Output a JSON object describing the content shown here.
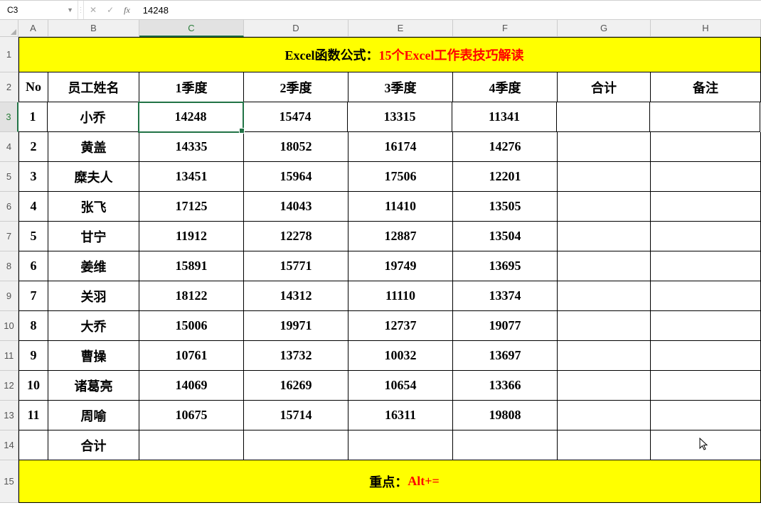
{
  "formula_bar": {
    "name_box": "C3",
    "formula_value": "14248"
  },
  "columns": [
    "A",
    "B",
    "C",
    "D",
    "E",
    "F",
    "G",
    "H"
  ],
  "active_col": "C",
  "active_row": "3",
  "title": {
    "prefix": "Excel函数公式：",
    "suffix": "15个Excel工作表技巧解读"
  },
  "headers": {
    "A": "No",
    "B": "员工姓名",
    "C": "1季度",
    "D": "2季度",
    "E": "3季度",
    "F": "4季度",
    "G": "合计",
    "H": "备注"
  },
  "rows": [
    {
      "no": "1",
      "name": "小乔",
      "q1": "14248",
      "q2": "15474",
      "q3": "13315",
      "q4": "11341",
      "sum": "",
      "note": ""
    },
    {
      "no": "2",
      "name": "黄盖",
      "q1": "14335",
      "q2": "18052",
      "q3": "16174",
      "q4": "14276",
      "sum": "",
      "note": ""
    },
    {
      "no": "3",
      "name": "糜夫人",
      "q1": "13451",
      "q2": "15964",
      "q3": "17506",
      "q4": "12201",
      "sum": "",
      "note": ""
    },
    {
      "no": "4",
      "name": "张飞",
      "q1": "17125",
      "q2": "14043",
      "q3": "11410",
      "q4": "13505",
      "sum": "",
      "note": ""
    },
    {
      "no": "5",
      "name": "甘宁",
      "q1": "11912",
      "q2": "12278",
      "q3": "12887",
      "q4": "13504",
      "sum": "",
      "note": ""
    },
    {
      "no": "6",
      "name": "姜维",
      "q1": "15891",
      "q2": "15771",
      "q3": "19749",
      "q4": "13695",
      "sum": "",
      "note": ""
    },
    {
      "no": "7",
      "name": "关羽",
      "q1": "18122",
      "q2": "14312",
      "q3": "11110",
      "q4": "13374",
      "sum": "",
      "note": ""
    },
    {
      "no": "8",
      "name": "大乔",
      "q1": "15006",
      "q2": "19971",
      "q3": "12737",
      "q4": "19077",
      "sum": "",
      "note": ""
    },
    {
      "no": "9",
      "name": "曹操",
      "q1": "10761",
      "q2": "13732",
      "q3": "10032",
      "q4": "13697",
      "sum": "",
      "note": ""
    },
    {
      "no": "10",
      "name": "诸葛亮",
      "q1": "14069",
      "q2": "16269",
      "q3": "10654",
      "q4": "13366",
      "sum": "",
      "note": ""
    },
    {
      "no": "11",
      "name": "周喻",
      "q1": "10675",
      "q2": "15714",
      "q3": "16311",
      "q4": "19808",
      "sum": "",
      "note": ""
    }
  ],
  "totals_row": {
    "label": "合计"
  },
  "footer": {
    "prefix": "重点：",
    "suffix": "Alt+="
  },
  "row_numbers": [
    "1",
    "2",
    "3",
    "4",
    "5",
    "6",
    "7",
    "8",
    "9",
    "10",
    "11",
    "12",
    "13",
    "14",
    "15"
  ]
}
